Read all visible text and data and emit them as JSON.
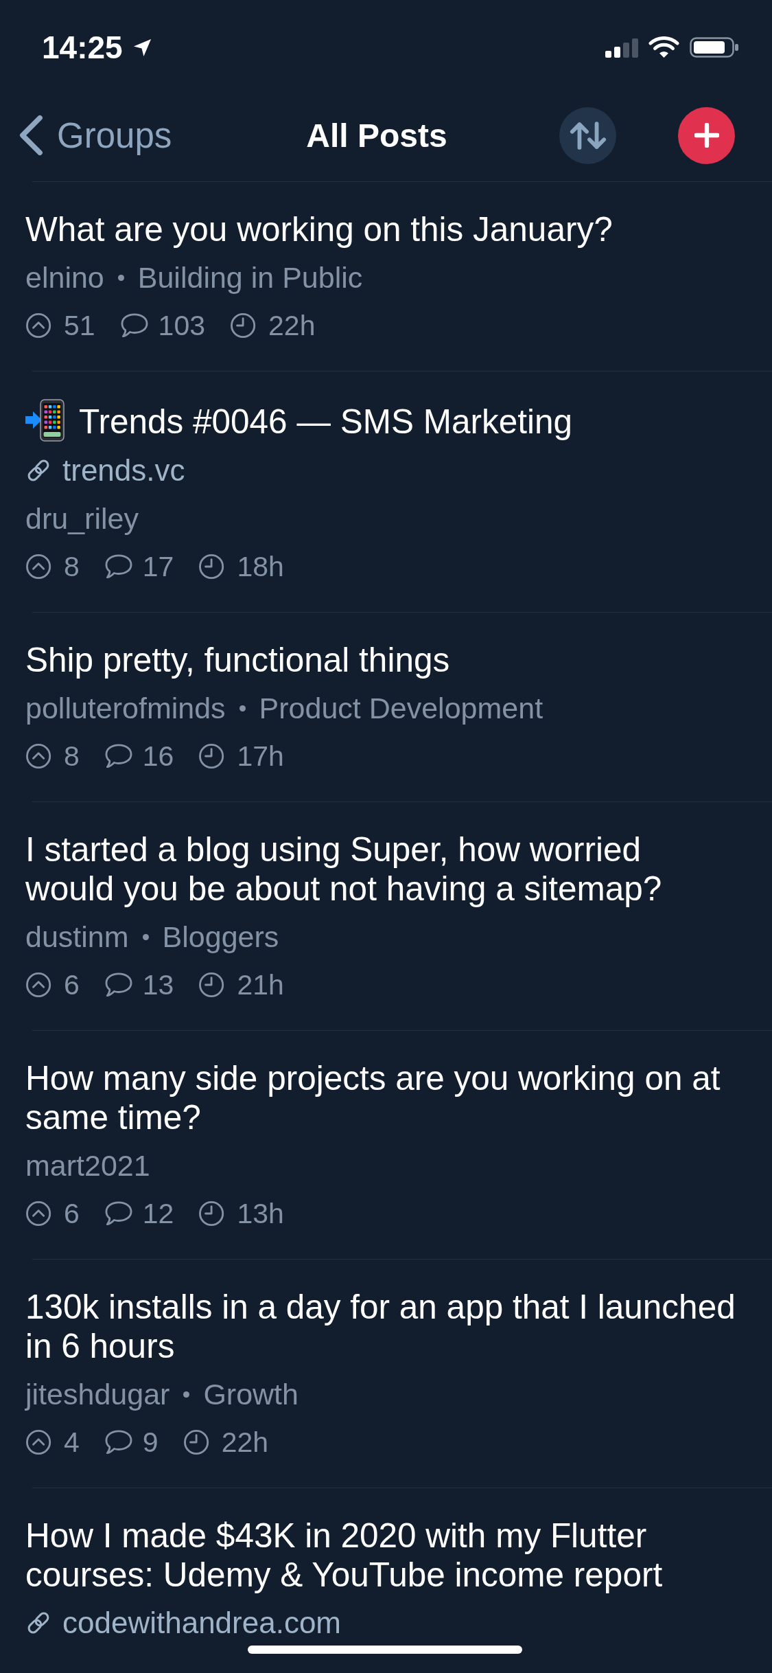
{
  "status_bar": {
    "time": "14:25"
  },
  "nav": {
    "back_label": "Groups",
    "title": "All Posts"
  },
  "posts": [
    {
      "title": "What are you working on this January?",
      "title_emoji": false,
      "author": "elnino",
      "group": "Building in Public",
      "upvotes": "51",
      "comments": "103",
      "age": "22h"
    },
    {
      "title": "Trends #0046 — SMS Marketing",
      "title_emoji": true,
      "link": "trends.vc",
      "author": "dru_riley",
      "upvotes": "8",
      "comments": "17",
      "age": "18h"
    },
    {
      "title": "Ship pretty, functional things",
      "title_emoji": false,
      "author": "polluterofminds",
      "group": "Product Development",
      "upvotes": "8",
      "comments": "16",
      "age": "17h"
    },
    {
      "title": "I started a blog using Super, how worried would you be about not having a sitemap?",
      "title_emoji": false,
      "author": "dustinm",
      "group": "Bloggers",
      "upvotes": "6",
      "comments": "13",
      "age": "21h"
    },
    {
      "title": "How many side projects are you working on at same time?",
      "title_emoji": false,
      "author": "mart2021",
      "upvotes": "6",
      "comments": "12",
      "age": "13h"
    },
    {
      "title": "130k installs in a day for an app that I launched in 6 hours",
      "title_emoji": false,
      "author": "jiteshdugar",
      "group": "Growth",
      "upvotes": "4",
      "comments": "9",
      "age": "22h"
    },
    {
      "title": "How I made $43K in 2020 with my Flutter courses: Udemy & YouTube income report",
      "title_emoji": false,
      "link": "codewithandrea.com"
    }
  ]
}
